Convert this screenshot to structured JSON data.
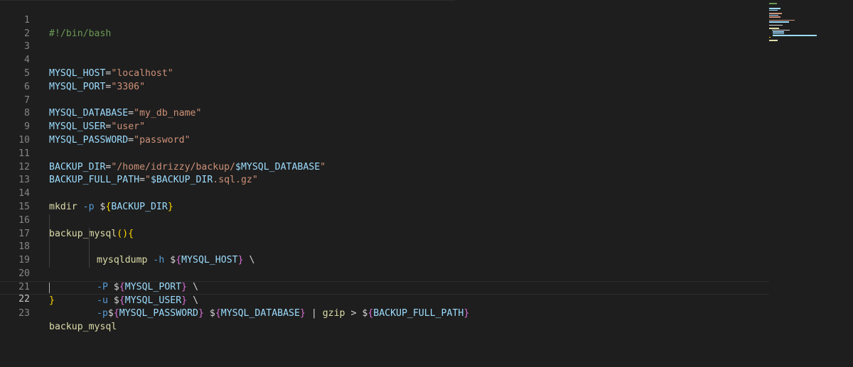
{
  "editor": {
    "line_numbers": [
      "1",
      "2",
      "3",
      "4",
      "5",
      "6",
      "7",
      "8",
      "9",
      "10",
      "11",
      "12",
      "13",
      "14",
      "15",
      "16",
      "17",
      "18",
      "19",
      "20",
      "21",
      "22",
      "23"
    ],
    "current_line": 22,
    "lines": {
      "l1": {
        "shebang": "#!/bin/bash"
      },
      "l4": {
        "var": "MYSQL_HOST",
        "eq": "=",
        "q1": "\"",
        "val": "localhost",
        "q2": "\""
      },
      "l5": {
        "var": "MYSQL_PORT",
        "eq": "=",
        "q1": "\"",
        "val": "3306",
        "q2": "\""
      },
      "l7": {
        "var": "MYSQL_DATABASE",
        "eq": "=",
        "q1": "\"",
        "val": "my_db_name",
        "q2": "\""
      },
      "l8": {
        "var": "MYSQL_USER",
        "eq": "=",
        "q1": "\"",
        "val": "user",
        "q2": "\""
      },
      "l9": {
        "var": "MYSQL_PASSWORD",
        "eq": "=",
        "q1": "\"",
        "val": "password",
        "q2": "\""
      },
      "l11": {
        "var": "BACKUP_DIR",
        "eq": "=",
        "q1": "\"",
        "val": "/home/idrizzy/backup/",
        "ref": "$MYSQL_DATABASE",
        "q2": "\""
      },
      "l12": {
        "var": "BACKUP_FULL_PATH",
        "eq": "=",
        "q1": "\"",
        "ref": "$BACKUP_DIR",
        "val": ".sql.gz",
        "q2": "\""
      },
      "l14": {
        "cmd": "mkdir",
        "flag": "-p",
        "dollar": "$",
        "open": "{",
        "ref": "BACKUP_DIR",
        "close": "}"
      },
      "l16": {
        "fn": "backup_mysql",
        "parens": "()",
        "brace": "{"
      },
      "l17": {
        "cmd": "mysqldump",
        "flag": "-h",
        "dollar": "$",
        "open": "{",
        "ref": "MYSQL_HOST",
        "close": "}",
        "cont": "\\"
      },
      "l18": {
        "flag": "-P",
        "dollar": "$",
        "open": "{",
        "ref": "MYSQL_PORT",
        "close": "}",
        "cont": "\\"
      },
      "l19": {
        "flag": "-u",
        "dollar": "$",
        "open": "{",
        "ref": "MYSQL_USER",
        "close": "}",
        "cont": "\\"
      },
      "l20": {
        "flag": "-p",
        "dollar1": "$",
        "open1": "{",
        "ref1": "MYSQL_PASSWORD",
        "close1": "}",
        "dollar2": "$",
        "open2": "{",
        "ref2": "MYSQL_DATABASE",
        "close2": "}",
        "pipe": "|",
        "cmd": "gzip",
        "redir": ">",
        "dollar3": "$",
        "open3": "{",
        "ref3": "BACKUP_FULL_PATH",
        "close3": "}"
      },
      "l21": {
        "brace": "}"
      },
      "l23": {
        "call": "backup_mysql"
      }
    }
  },
  "colors": {
    "background": "#1e1e1e",
    "variable": "#9cdcfe",
    "string": "#ce9178",
    "comment": "#6a9955",
    "function": "#dcdcaa",
    "bracket_level_1": "#ffd700",
    "bracket_level_2": "#da70d6",
    "flag": "#569cd6",
    "line_number": "#858585"
  }
}
